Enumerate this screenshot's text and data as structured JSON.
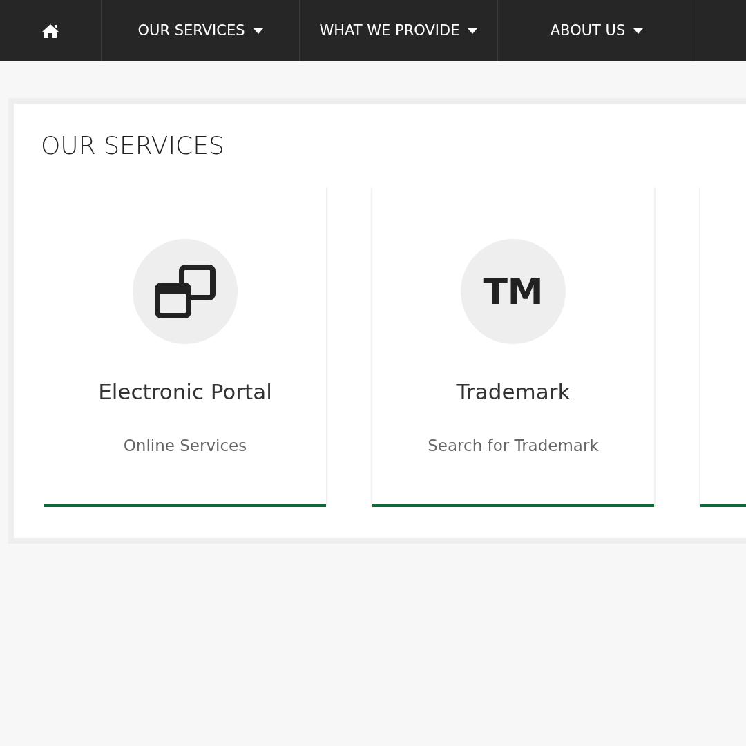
{
  "nav": {
    "items": [
      {
        "kind": "home"
      },
      {
        "kind": "menu",
        "label": "OUR SERVICES"
      },
      {
        "kind": "menu",
        "label": "WHAT WE PROVIDE"
      },
      {
        "kind": "menu",
        "label": "ABOUT US"
      }
    ]
  },
  "section": {
    "title": "OUR SERVICES",
    "cards": [
      {
        "kind": "icon",
        "title": "Electronic Portal",
        "subtitle": "Online Services"
      },
      {
        "kind": "text",
        "icon_text": "TM",
        "title": "Trademark",
        "subtitle": "Search for Trademark"
      }
    ]
  }
}
